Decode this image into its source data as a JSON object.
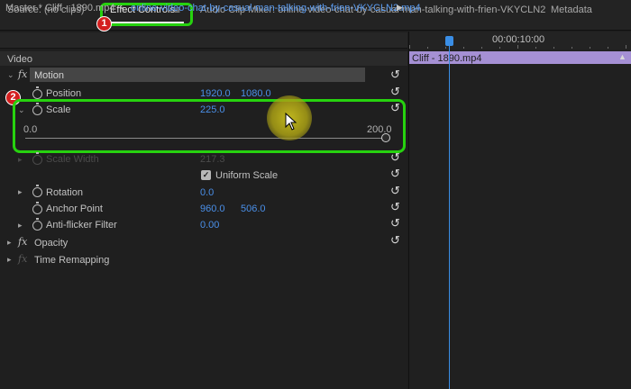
{
  "tabs": {
    "source": "Source: (no clips)",
    "effect_controls": "Effect Controls",
    "effect_menu": "≡",
    "audio_mixer": "Audio Clip Mixer: online-video-chat-by-casual-man-talking-with-frien-VKYCLN2",
    "metadata": "Metadata"
  },
  "badges": {
    "one": "1",
    "two": "2"
  },
  "clip_header": {
    "master": "Master * Cliff - 1890.mp4",
    "chevron": "⌄",
    "clip": "online-video-chat-by-casual-man-talking-with-frien-VKYCLN2.mp4",
    "play": "▶"
  },
  "effects": {
    "video_header": "Video",
    "fx": "fx",
    "motion": "Motion",
    "position": {
      "label": "Position",
      "x": "1920.0",
      "y": "1080.0"
    },
    "scale": {
      "label": "Scale",
      "value": "225.0",
      "min": "0.0",
      "max": "200.0"
    },
    "scale_width": {
      "label": "Scale Width",
      "value": "217.3"
    },
    "uniform_scale": {
      "label": "Uniform Scale",
      "checked": true,
      "check": "✓"
    },
    "rotation": {
      "label": "Rotation",
      "value": "0.0"
    },
    "anchor_point": {
      "label": "Anchor Point",
      "x": "960.0",
      "y": "506.0"
    },
    "anti_flicker": {
      "label": "Anti-flicker Filter",
      "value": "0.00"
    },
    "opacity": "Opacity",
    "time_remapping": "Time Remapping"
  },
  "timeline": {
    "timecode": "00:00:10:00",
    "clip_name": "Cliff - 1890.mp4",
    "scroll": "▲"
  },
  "colors": {
    "highlight": "#27d20f",
    "value_blue": "#4a8fe8",
    "clip_purple": "#a590d4",
    "playhead": "#3a8ee6",
    "badge_red": "#d41f1f"
  },
  "icons": {
    "reset": "↺",
    "stopwatch": "stopwatch-icon",
    "expand": "▸",
    "collapse": "⌄"
  }
}
